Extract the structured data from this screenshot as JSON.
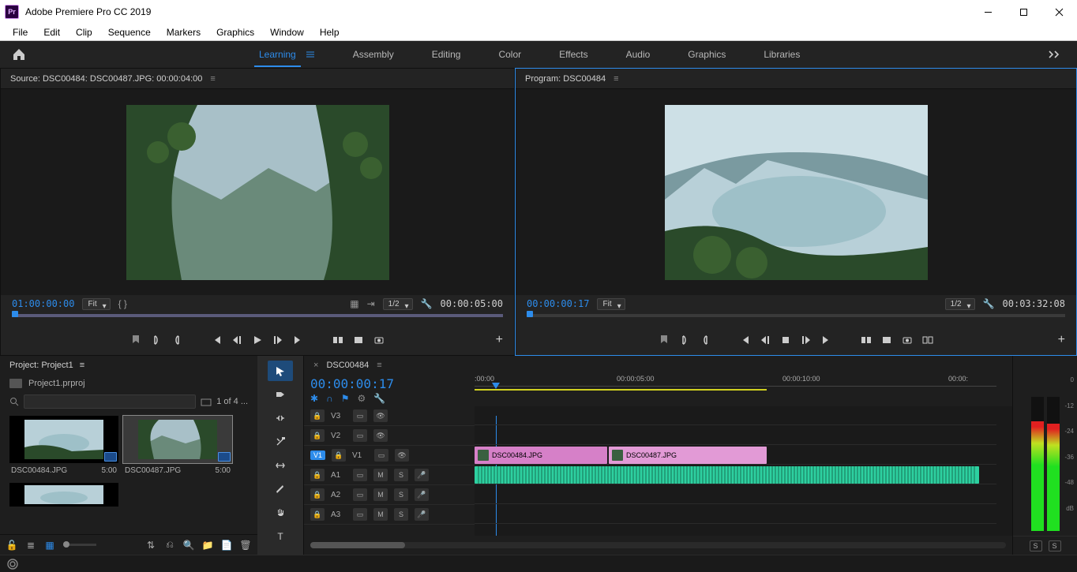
{
  "window": {
    "title": "Adobe Premiere Pro CC 2019",
    "app_abbrev": "Pr"
  },
  "menubar": [
    "File",
    "Edit",
    "Clip",
    "Sequence",
    "Markers",
    "Graphics",
    "Window",
    "Help"
  ],
  "workspaces": {
    "items": [
      "Learning",
      "Assembly",
      "Editing",
      "Color",
      "Effects",
      "Audio",
      "Graphics",
      "Libraries"
    ],
    "active_index": 0
  },
  "source_panel": {
    "title": "Source: DSC00484: DSC00487.JPG: 00:00:04:00",
    "timecode_left": "01:00:00:00",
    "timecode_right": "00:00:05:00",
    "zoom": "Fit",
    "resolution": "1/2"
  },
  "program_panel": {
    "title": "Program: DSC00484",
    "timecode_left": "00:00:00:17",
    "timecode_right": "00:03:32:08",
    "zoom": "Fit",
    "resolution": "1/2"
  },
  "project_panel": {
    "tab": "Project: Project1",
    "filename": "Project1.prproj",
    "search_placeholder": "",
    "bin_count": "1 of 4 ...",
    "items": [
      {
        "name": "DSC00484.JPG",
        "dur": "5:00"
      },
      {
        "name": "DSC00487.JPG",
        "dur": "5:00"
      }
    ]
  },
  "timeline": {
    "sequence": "DSC00484",
    "playhead": "00:00:00:17",
    "ruler": [
      {
        "label": ":00:00",
        "pos": 0
      },
      {
        "label": "00:00:05:00",
        "pos": 210
      },
      {
        "label": "00:00:10:00",
        "pos": 400
      },
      {
        "label": "00:00:",
        "pos": 610
      }
    ],
    "video_tracks": [
      "V3",
      "V2",
      "V1"
    ],
    "audio_tracks": [
      "A1",
      "A2",
      "A3"
    ],
    "clips": {
      "v1a": "DSC00484.JPG",
      "v1b": "DSC00487.JPG"
    }
  },
  "meters": {
    "scale": [
      "0",
      "-12",
      "-24",
      "-36",
      "-48",
      "dB"
    ],
    "solo": "S"
  }
}
